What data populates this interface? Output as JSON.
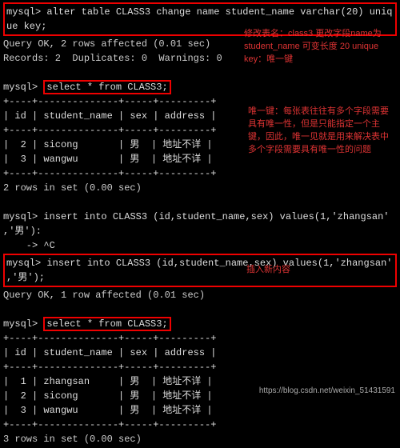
{
  "cmd1_prompt": "mysql> ",
  "cmd1a": "alter table CLASS3 change name student_name varchar(20) uniq",
  "cmd1b": "ue key;",
  "res1a": "Query OK, 2 rows affected (0.01 sec)",
  "res1b": "Records: 2  Duplicates: 0  Warnings: 0",
  "cmd2_prompt": "mysql> ",
  "cmd2": "select * from CLASS3;",
  "tbl1_sep": "+----+--------------+-----+---------+",
  "tbl1_head": "| id | student_name | sex | address |",
  "tbl1_r1": "|  2 | sicong       | 男  | 地址不详 |",
  "tbl1_r2": "|  3 | wangwu       | 男  | 地址不详 |",
  "tbl1_foot": "2 rows in set (0.00 sec)",
  "cmd3_prompt": "mysql> ",
  "cmd3a": "insert into CLASS3 (id,student_name,sex) values(1,'zhangsan'",
  "cmd3b": ",'男'):",
  "cmd3c": "    -> ^C",
  "cmd4_prompt": "mysql> ",
  "cmd4a": "insert into CLASS3 (id,student_name,sex) values(1,'zhangsan'",
  "cmd4b": ",'男');",
  "res4": "Query OK, 1 row affected (0.01 sec)",
  "cmd5_prompt": "mysql> ",
  "cmd5": "select * from CLASS3;",
  "tbl2_sep": "+----+--------------+-----+---------+",
  "tbl2_head": "| id | student_name | sex | address |",
  "tbl2_r1": "|  1 | zhangsan     | 男  | 地址不详 |",
  "tbl2_r2": "|  2 | sicong       | 男  | 地址不详 |",
  "tbl2_r3": "|  3 | wangwu       | 男  | 地址不详 |",
  "tbl2_foot": "3 rows in set (0.00 sec)",
  "note1": "修改表名：class3 更改字段name为 student_name 可变长度 20 unique key：唯一键",
  "note2": "唯一键：每张表往往有多个字段需要具有唯一性，但是只能指定一个主键，因此，唯一见就是用来解决表中多个字段需要具有唯一性的问题",
  "note3": "插入新内容",
  "watermark": "https://blog.csdn.net/weixin_51431591"
}
